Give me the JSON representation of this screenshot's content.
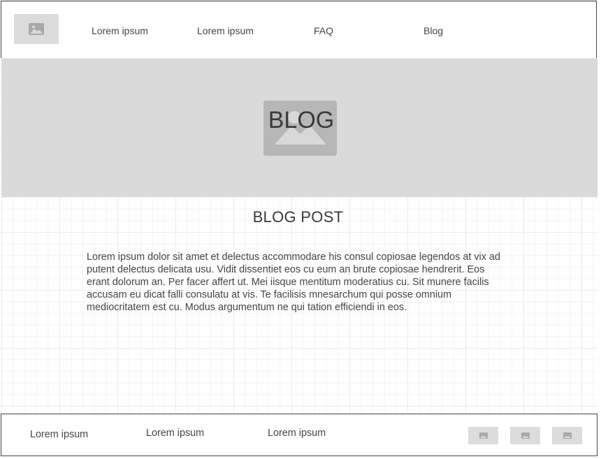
{
  "header": {
    "logo_icon": "image-placeholder-icon",
    "nav": [
      "Lorem ipsum",
      "Lorem ipsum",
      "FAQ",
      "Blog"
    ]
  },
  "hero": {
    "title": "BLOG",
    "image_icon": "image-placeholder-icon"
  },
  "post": {
    "title": "BLOG POST",
    "body": "Lorem ipsum dolor sit amet et delectus accommodare his consul copiosae legendos at vix ad putent delectus delicata usu. Vidit dissentiet eos cu eum an brute copiosae hendrerit. Eos erant dolorum an. Per facer affert ut. Mei iisque mentitum moderatius cu. Sit munere facilis accusam eu dicat falli consulatu at vis. Te facilisis mnesarchum qui posse omnium mediocritatem est cu. Modus argumentum ne qui tation efficiendi in eos."
  },
  "footer": {
    "links": [
      "Lorem ipsum",
      "Lorem ipsum",
      "Lorem ipsum"
    ],
    "social_icons": [
      "image-placeholder-icon",
      "image-placeholder-icon",
      "image-placeholder-icon"
    ]
  },
  "colors": {
    "placeholder": "#dcdcdc",
    "hero_bg": "#dadada",
    "hero_image": "#b7b7b7",
    "text": "#444444"
  }
}
